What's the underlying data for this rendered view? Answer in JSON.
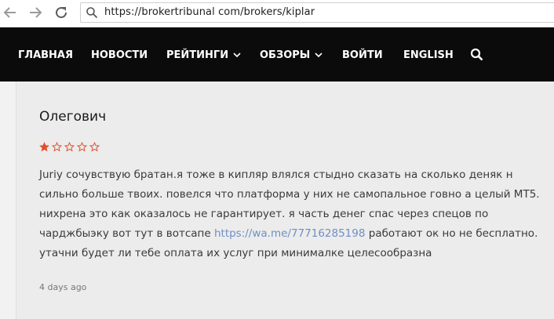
{
  "browser": {
    "url": "https://brokertribunal com/brokers/kiplar"
  },
  "nav": {
    "items": [
      {
        "label": "ГЛАВНАЯ"
      },
      {
        "label": "НОВОСТИ"
      },
      {
        "label": "РЕЙТИНГИ"
      },
      {
        "label": "ОБЗОРЫ"
      },
      {
        "label": "ВОЙТИ"
      },
      {
        "label": "ENGLISH"
      }
    ]
  },
  "review": {
    "author": "Олегович",
    "rating": 1,
    "rating_max": 5,
    "star_color": "#e0502e",
    "lines": [
      "Juriy сочувствую братан.я тоже в кипляр влялся стыдно сказать на сколько деняк н",
      "сильно больше твоих. повелся что платформа у них не самопальное говно а целый МТ5.",
      "нихрена это как оказалось не гарантирует. я часть денег спас через спецов по"
    ],
    "line4_before": "чарджбыэку вот тут в вотсапе ",
    "link": "https://wa.me/77716285198",
    "line4_after": " работают ок но не бесплатно.",
    "line5": "утачни будет ли тебе оплата их услуг при минималке целесообразна",
    "time": "4 days ago"
  }
}
